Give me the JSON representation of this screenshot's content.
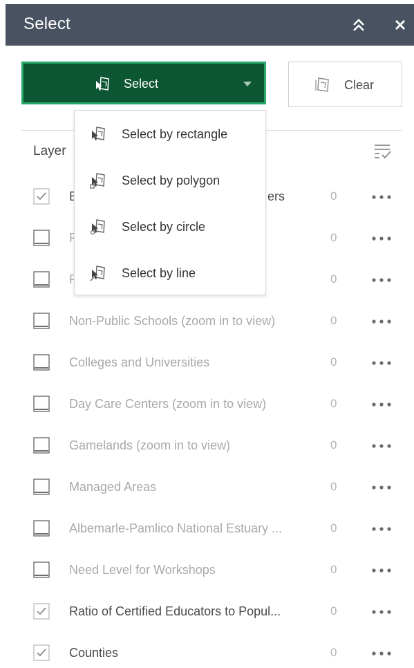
{
  "header": {
    "title": "Select",
    "collapse_icon": "double-chevron-up-icon",
    "close_icon": "close-icon",
    "background": "#485261"
  },
  "toolbar": {
    "select_label": "Select",
    "clear_label": "Clear",
    "accent": "#0d5634",
    "accent_border": "#28a86a"
  },
  "dropdown": {
    "items": [
      {
        "label": "Select by rectangle",
        "icon": "select-rectangle-icon"
      },
      {
        "label": "Select by polygon",
        "icon": "select-polygon-icon"
      },
      {
        "label": "Select by circle",
        "icon": "select-circle-icon"
      },
      {
        "label": "Select by line",
        "icon": "select-line-icon"
      }
    ]
  },
  "layers": {
    "label": "Layer",
    "rows": [
      {
        "name": "E",
        "suffix": "ers",
        "count": "0",
        "checked": true
      },
      {
        "name": "F",
        "count": "0",
        "checked": false
      },
      {
        "name": "F",
        "count": "0",
        "checked": false
      },
      {
        "name": "Non-Public Schools (zoom in to view)",
        "count": "0",
        "checked": false
      },
      {
        "name": "Colleges and Universities",
        "count": "0",
        "checked": false
      },
      {
        "name": "Day Care Centers (zoom in to view)",
        "count": "0",
        "checked": false
      },
      {
        "name": "Gamelands (zoom in to view)",
        "count": "0",
        "checked": false
      },
      {
        "name": "Managed Areas",
        "count": "0",
        "checked": false
      },
      {
        "name": "Albemarle-Pamlico National Estuary ...",
        "count": "0",
        "checked": false
      },
      {
        "name": "Need Level for Workshops",
        "count": "0",
        "checked": false
      },
      {
        "name": "Ratio of Certified Educators to Popul...",
        "count": "0",
        "checked": true
      },
      {
        "name": "Counties",
        "count": "0",
        "checked": true
      }
    ]
  }
}
